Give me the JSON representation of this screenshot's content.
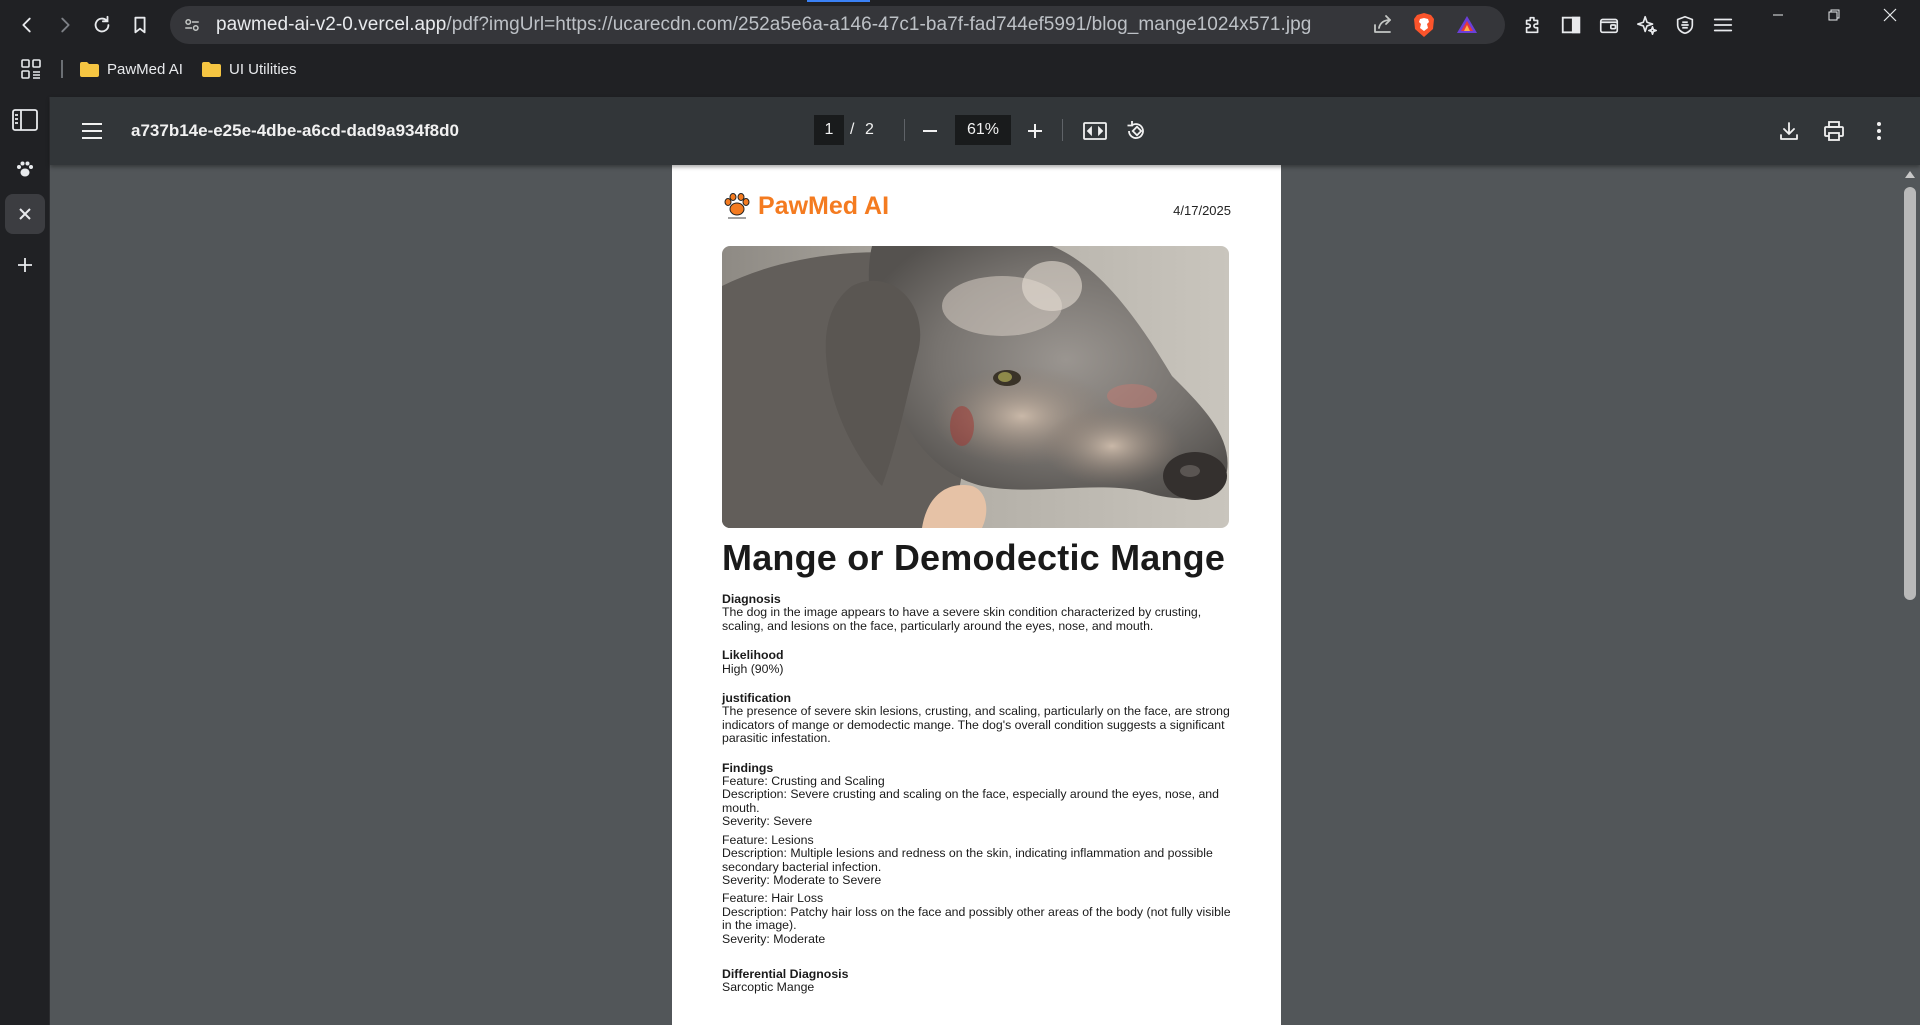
{
  "browser": {
    "url_domain": "pawmed-ai-v2-0.vercel.app",
    "url_rest": "/pdf?imgUrl=https://ucarecdn.com/252a5e6a-a146-47c1-ba7f-fad744ef5991/blog_mange1024x571.jpg"
  },
  "bookmarks": [
    {
      "label": "PawMed AI"
    },
    {
      "label": "UI Utilities"
    }
  ],
  "pdf": {
    "doc_title": "a737b14e-e25e-4dbe-a6cd-dad9a934f8d0",
    "current_page": "1",
    "page_sep": "/",
    "total_pages": "2",
    "zoom": "61%"
  },
  "report": {
    "brand": "PawMed AI",
    "date": "4/17/2025",
    "title": "Mange or Demodectic Mange",
    "diagnosis_heading": "Diagnosis",
    "diagnosis_text": "The dog in the image appears to have a severe skin condition characterized by crusting, scaling, and lesions on the face, particularly around the eyes, nose, and mouth.",
    "likelihood_heading": "Likelihood",
    "likelihood_text": "High (90%)",
    "justification_heading": "justification",
    "justification_text": "The presence of severe skin lesions, crusting, and scaling, particularly on the face, are strong indicators of mange or demodectic mange. The dog's overall condition suggests a significant parasitic infestation.",
    "findings_heading": "Findings",
    "findings": [
      {
        "feature": "Feature: Crusting and Scaling",
        "description": "Description: Severe crusting and scaling on the face, especially around the eyes, nose, and mouth.",
        "severity": "Severity: Severe"
      },
      {
        "feature": "Feature: Lesions",
        "description": "Description: Multiple lesions and redness on the skin, indicating inflammation and possible secondary bacterial infection.",
        "severity": "Severity: Moderate to Severe"
      },
      {
        "feature": "Feature: Hair Loss",
        "description": "Description: Patchy hair loss on the face and possibly other areas of the body (not fully visible in the image).",
        "severity": "Severity: Moderate"
      }
    ],
    "differential_heading": "Differential Diagnosis",
    "differential_text": "Sarcoptic Mange"
  },
  "colors": {
    "brand_orange": "#f47b20",
    "viewer_bg": "#525659",
    "toolbar_bg": "#323639"
  }
}
